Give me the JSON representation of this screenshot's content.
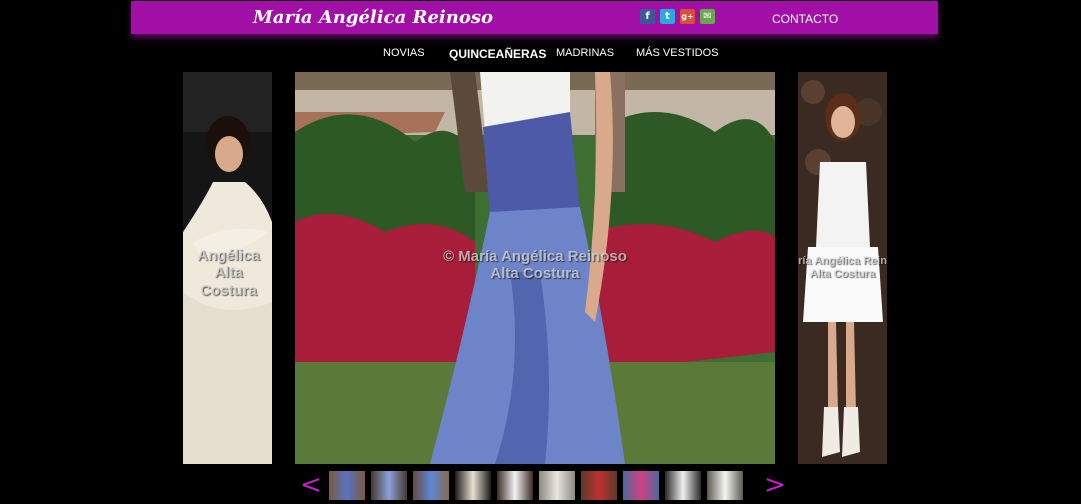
{
  "header": {
    "logo_text": "María Angélica Reinoso",
    "contact_label": "CONTACTO",
    "brand_color": "#a10fa6",
    "social": [
      {
        "name": "facebook-icon",
        "glyph": "f",
        "color": "#3b5998"
      },
      {
        "name": "twitter-icon",
        "glyph": "t",
        "color": "#2aa9e0"
      },
      {
        "name": "google-plus-icon",
        "glyph": "g+",
        "color": "#dd4b39"
      },
      {
        "name": "email-icon",
        "glyph": "✉",
        "color": "#6aa84f"
      }
    ]
  },
  "nav": {
    "items": [
      {
        "label": "NOVIAS",
        "active": false
      },
      {
        "label": "QUINCEAÑERAS",
        "active": true
      },
      {
        "label": "MADRINAS",
        "active": false
      },
      {
        "label": "MÁS VESTIDOS",
        "active": false
      }
    ]
  },
  "gallery": {
    "main_watermark_line1": "© María Angélica Reinoso",
    "main_watermark_line2": "Alta Costura",
    "left_watermark_line1": "Angélica",
    "left_watermark_line2": "Alta Costura",
    "right_watermark_line1": "ría Angélica Rein",
    "right_watermark_line2": "Alta Costura",
    "prev_glyph": "<",
    "next_glyph": ">",
    "thumbnail_count": 10
  }
}
